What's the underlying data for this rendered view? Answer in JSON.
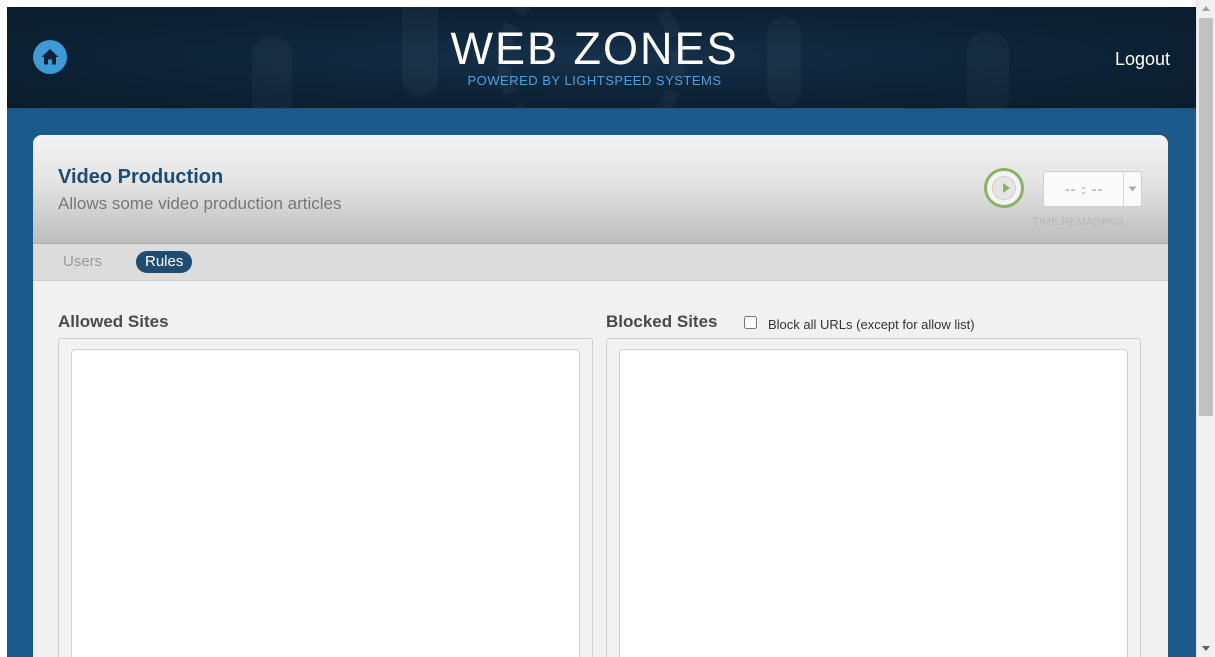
{
  "header": {
    "brand_title": "WEB ZONES",
    "brand_subtitle": "POWERED BY LIGHTSPEED SYSTEMS",
    "home_icon": "home-icon",
    "logout_label": "Logout"
  },
  "zone": {
    "title": "Video Production",
    "description": "Allows some video production articles",
    "play_icon": "play-icon",
    "time_value": "-- : --",
    "time_label": "TIME REMAINING"
  },
  "tabs": [
    {
      "label": "Users",
      "active": false
    },
    {
      "label": "Rules",
      "active": true
    }
  ],
  "rules": {
    "allowed_label": "Allowed Sites",
    "allowed_value": "",
    "blocked_label": "Blocked Sites",
    "blocked_value": "",
    "block_all_label": "Block all URLs (except for allow list)",
    "block_all_checked": false
  },
  "colors": {
    "header_bg": "#0d2236",
    "page_bg": "#1c5a8c",
    "accent_blue": "#1f4d72",
    "home_blue": "#3d9ad6",
    "subtitle_blue": "#4ea2dc",
    "play_green": "#8cb264"
  }
}
